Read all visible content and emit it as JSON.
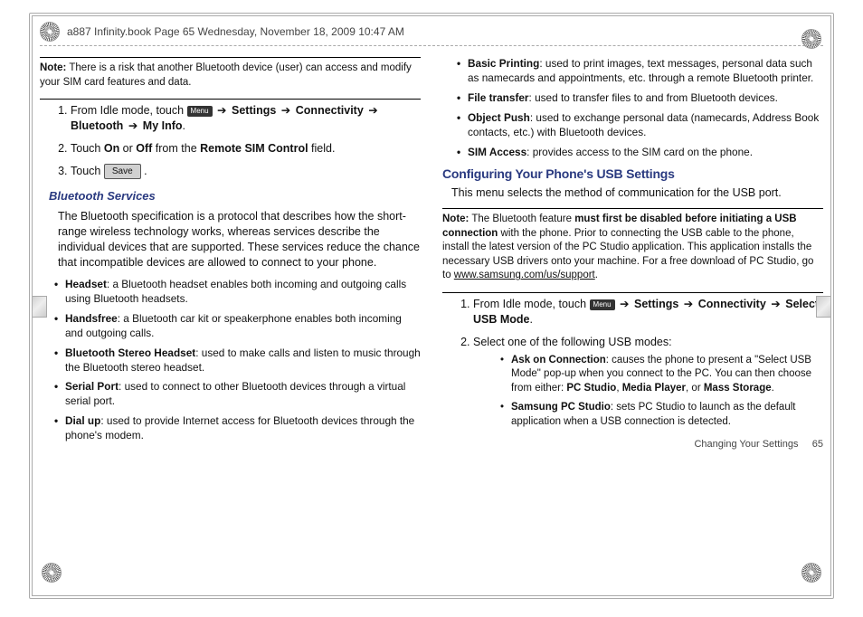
{
  "header": {
    "running_head": "a887 Infinity.book  Page 65  Wednesday, November 18, 2009  10:47 AM"
  },
  "note_top": {
    "label": "Note:",
    "body": "There is a risk that another Bluetooth device (user) can access and modify your SIM card features and data."
  },
  "steps_a": {
    "s1_prefix": "From Idle mode, touch ",
    "menu_label": "Menu",
    "arrow": "➔",
    "settings": "Settings",
    "connectivity": "Connectivity",
    "bluetooth": "Bluetooth",
    "myinfo": "My Info",
    "s2_a": "Touch ",
    "s2_on": "On",
    "s2_or": " or ",
    "s2_off": "Off",
    "s2_b": " from the ",
    "s2_field": "Remote SIM Control",
    "s2_c": " field.",
    "s3_a": "Touch ",
    "save_label": "Save",
    "s3_b": " ."
  },
  "bt_services": {
    "heading": "Bluetooth Services",
    "intro": "The Bluetooth specification is a protocol that describes how the short-range wireless technology works, whereas services describe the individual devices that are supported. These services reduce the chance that incompatible devices are allowed to connect to your phone.",
    "items": [
      {
        "term": "Headset",
        "desc": ": a Bluetooth headset enables both incoming and outgoing calls using Bluetooth headsets."
      },
      {
        "term": "Handsfree",
        "desc": ": a Bluetooth car kit or speakerphone enables both incoming and outgoing calls."
      },
      {
        "term": "Bluetooth Stereo Headset",
        "desc": ": used to make calls and listen to music through the Bluetooth stereo headset."
      },
      {
        "term": "Serial Port",
        "desc": ": used to connect to other Bluetooth devices through a virtual serial port."
      },
      {
        "term": "Dial up",
        "desc": ": used to provide Internet access for Bluetooth devices through the phone's modem."
      }
    ]
  },
  "bt_services_right": [
    {
      "term": "Basic Printing",
      "desc": ": used to print images, text messages, personal data such as namecards and appointments, etc. through a remote Bluetooth printer."
    },
    {
      "term": "File transfer",
      "desc": ": used to transfer files to and from Bluetooth devices."
    },
    {
      "term": "Object Push",
      "desc": ": used to exchange personal data (namecards, Address Book contacts, etc.) with Bluetooth devices."
    },
    {
      "term": "SIM Access",
      "desc": ": provides access to the SIM card on the phone."
    }
  ],
  "usb": {
    "heading": "Configuring Your Phone's USB Settings",
    "intro": "This menu selects the method of communication for the USB port.",
    "note_label": "Note:",
    "note_a": "The Bluetooth feature ",
    "note_bold": "must first be disabled before initiating a USB connection",
    "note_b": " with the phone. Prior to connecting the USB cable to the phone, install the latest version of the PC Studio application. This application installs the necessary USB drivers onto your machine. For a free download of PC Studio, go to ",
    "note_link": "www.samsung.com/us/support",
    "menu_label": "Menu",
    "arrow": "➔",
    "s1_prefix": "From Idle mode, touch ",
    "settings": "Settings",
    "connectivity": "Connectivity",
    "select_usb": "Select USB Mode",
    "s2": "Select one of the following USB modes:",
    "modes": [
      {
        "term": "Ask on Connection",
        "desc": ": causes the phone to present a \"Select USB Mode\" pop-up when you connect to the PC. You can then choose from either: ",
        "opt1": "PC Studio",
        "opt2": "Media Player",
        "or": ", or ",
        "opt3": "Mass Storage",
        "end": "."
      },
      {
        "term": "Samsung PC Studio",
        "desc": ": sets PC Studio to launch as the default application when a USB connection is detected."
      }
    ]
  },
  "footer": {
    "section": "Changing Your Settings",
    "page": "65"
  }
}
